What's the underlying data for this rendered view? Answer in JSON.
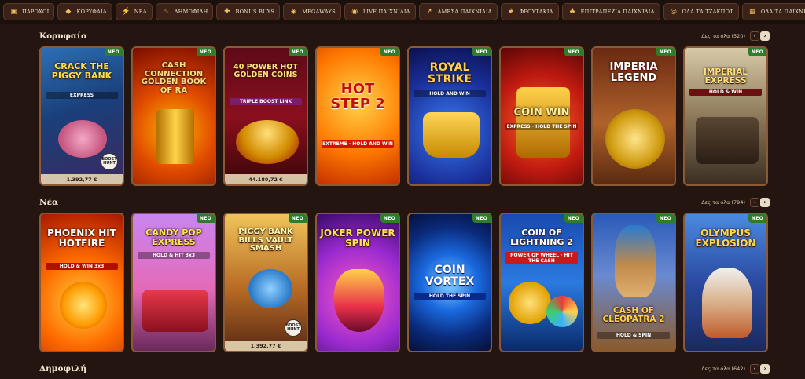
{
  "nav": {
    "items": [
      {
        "label": "ΠΑΡΟΧΟΙ",
        "icon": "providers-icon",
        "glyph": "▣"
      },
      {
        "label": "ΚΟΡΥΦΑΙΑ",
        "icon": "diamond-icon",
        "glyph": "◆"
      },
      {
        "label": "ΝΕΑ",
        "icon": "lightning-icon",
        "glyph": "⚡"
      },
      {
        "label": "ΔΗΜΟΦΙΛΗ",
        "icon": "fire-icon",
        "glyph": "♨"
      },
      {
        "label": "BONUS BUYS",
        "icon": "gift-icon",
        "glyph": "✚"
      },
      {
        "label": "MEGAWAYS",
        "icon": "megaways-icon",
        "glyph": "◈"
      },
      {
        "label": "LIVE ΠΑΙΧΝΙΔΙΑ",
        "icon": "live-icon",
        "glyph": "◉"
      },
      {
        "label": "ΑΜΕΣΑ ΠΑΙΧΝΙΔΙΑ",
        "icon": "rocket-icon",
        "glyph": "➚"
      },
      {
        "label": "ΦΡΟΥΤΑΚΙΑ",
        "icon": "cherry-icon",
        "glyph": "❦"
      },
      {
        "label": "ΕΠΙΤΡΑΠΕΖΙΑ ΠΑΙΧΝΙΔΙΑ",
        "icon": "clover-icon",
        "glyph": "♣"
      },
      {
        "label": "ΟΛΑ ΤΑ ΤΖΑΚΠΟΤ",
        "icon": "coin-icon",
        "glyph": "◎"
      },
      {
        "label": "ΟΛΑ ΤΑ ΠΑΙΧΝΙΔΙΑ",
        "icon": "all-games-icon",
        "glyph": "▦"
      }
    ]
  },
  "sections": {
    "top": {
      "title": "Κορυφαία",
      "see_all": "Δες τα όλα (520)",
      "prev": "‹",
      "next": "›",
      "games": [
        {
          "title": "CRACK THE PIGGY BANK",
          "sub": "EXPRESS",
          "badge": "ΝΕΟ",
          "jackpot": "1.392,77 €",
          "drop": "BOOST HUNT"
        },
        {
          "title": "CASH CONNECTION GOLDEN BOOK OF RA",
          "sub": "",
          "badge": "ΝΕΟ",
          "jackpot": "",
          "drop": ""
        },
        {
          "title": "40 POWER HOT GOLDEN COINS",
          "sub": "TRIPLE BOOST LINK",
          "badge": "ΝΕΟ",
          "jackpot": "44.180,72 €",
          "drop": ""
        },
        {
          "title": "HOT STEP 2",
          "sub": "EXTREME · HOLD AND WIN",
          "badge": "ΝΕΟ",
          "jackpot": "",
          "drop": ""
        },
        {
          "title": "ROYAL STRIKE",
          "sub": "HOLD AND WIN",
          "badge": "ΝΕΟ",
          "jackpot": "",
          "drop": ""
        },
        {
          "title": "COIN WIN",
          "sub": "EXPRESS · HOLD THE SPIN",
          "badge": "ΝΕΟ",
          "jackpot": "",
          "drop": ""
        },
        {
          "title": "IMPERIA LEGEND",
          "sub": "",
          "badge": "ΝΕΟ",
          "jackpot": "",
          "drop": ""
        },
        {
          "title": "IMPERIAL EXPRESS",
          "sub": "HOLD & WIN",
          "badge": "ΝΕΟ",
          "jackpot": "",
          "drop": ""
        }
      ]
    },
    "new": {
      "title": "Νέα",
      "see_all": "Δες τα όλα (794)",
      "prev": "‹",
      "next": "›",
      "games": [
        {
          "title": "PHOENIX HIT HOTFIRE",
          "sub": "HOLD & WIN 3x3",
          "badge": "",
          "jackpot": "",
          "drop": ""
        },
        {
          "title": "CANDY POP EXPRESS",
          "sub": "HOLD & HIT 3x3",
          "badge": "ΝΕΟ",
          "jackpot": "",
          "drop": ""
        },
        {
          "title": "PIGGY BANK BILLS VAULT SMASH",
          "sub": "",
          "badge": "ΝΕΟ",
          "jackpot": "1.392,77 €",
          "drop": "BOOST HUNT"
        },
        {
          "title": "JOKER POWER SPIN",
          "sub": "",
          "badge": "ΝΕΟ",
          "jackpot": "",
          "drop": ""
        },
        {
          "title": "COIN VORTEX",
          "sub": "HOLD THE SPIN",
          "badge": "ΝΕΟ",
          "jackpot": "",
          "drop": ""
        },
        {
          "title": "COIN OF LIGHTNING 2",
          "sub": "POWER OF WHEEL · HIT THE CASH",
          "badge": "ΝΕΟ",
          "jackpot": "",
          "drop": ""
        },
        {
          "title": "CASH OF CLEOPATRA 2",
          "sub": "HOLD & SPIN",
          "badge": "ΝΕΟ",
          "jackpot": "",
          "drop": ""
        },
        {
          "title": "OLYMPUS EXPLOSION",
          "sub": "",
          "badge": "ΝΕΟ",
          "jackpot": "",
          "drop": ""
        }
      ]
    },
    "popular": {
      "title": "Δημοφιλή",
      "see_all": "Δες τα όλα (642)",
      "prev": "‹",
      "next": "›"
    }
  },
  "colors": {
    "background": "#241510",
    "badge_new": "#2f7d2c",
    "tile_border": "#8a5a36"
  }
}
